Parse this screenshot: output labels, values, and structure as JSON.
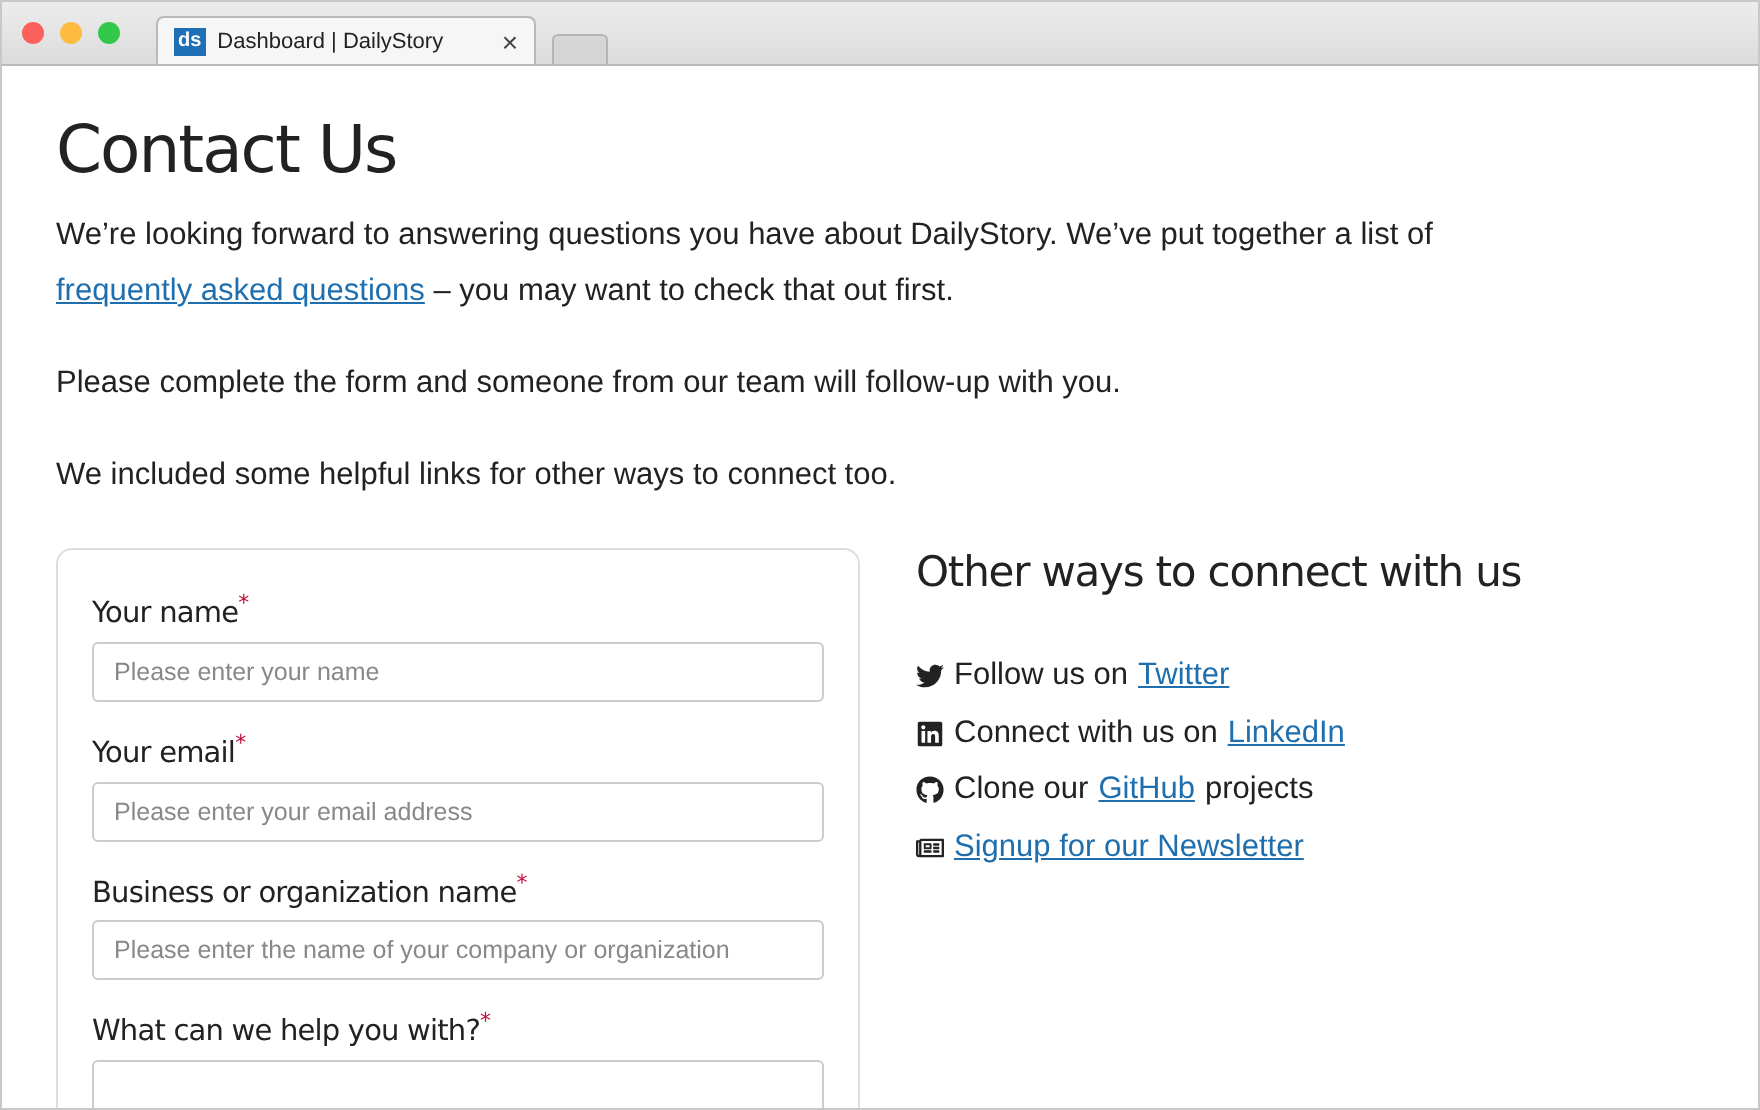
{
  "browser": {
    "tab": {
      "favicon": "ds",
      "title": "Dashboard | DailyStory",
      "close": "×",
      "selected": true
    }
  },
  "page": {
    "title": "Contact Us",
    "intro": {
      "before": "We’re looking forward to answering questions you have about DailyStory. We’ve put together a list of",
      "link": "frequently asked questions",
      "after": "– you may want to check that out first."
    },
    "paragraphs": [
      "Please complete the form and someone from our team will follow-up with you.",
      "We included some helpful links for other ways to connect too."
    ],
    "form": {
      "fields": [
        {
          "kind": "input",
          "label": "Your name",
          "required_mark": "*",
          "placeholder": "Please enter your name"
        },
        {
          "kind": "input",
          "label": "Your email",
          "required_mark": "*",
          "placeholder": "Please enter your email address"
        },
        {
          "kind": "input",
          "label": "Business or organization name",
          "required_mark": "*",
          "placeholder": "Please enter the name of your company or organization"
        },
        {
          "kind": "textarea",
          "label": "What can we help you with?",
          "required_mark": "*"
        }
      ]
    },
    "connect": {
      "title": "Other ways to connect with us",
      "items": [
        {
          "kind": "twitter",
          "before": "Follow us on",
          "link": "Twitter"
        },
        {
          "kind": "linkedin",
          "before": "Connect with us on",
          "link": "LinkedIn"
        },
        {
          "kind": "github",
          "before": "Clone our",
          "link": "GitHub",
          "after": "projects"
        },
        {
          "kind": "newsletter",
          "link": "Signup for our Newsletter"
        }
      ]
    }
  }
}
